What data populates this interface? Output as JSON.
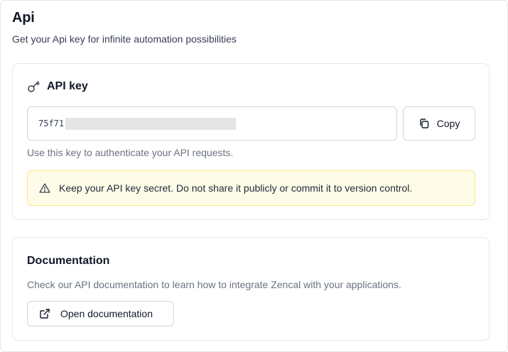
{
  "page": {
    "title": "Api",
    "subtitle": "Get your Api key for infinite automation possibilities"
  },
  "api_card": {
    "title": "API key",
    "title_icon": "key-icon",
    "key_prefix": "75f71",
    "copy_label": "Copy",
    "copy_icon": "copy-icon",
    "help_text": "Use this key to authenticate your API requests.",
    "warning_text": "Keep your API key secret. Do not share it publicly or commit it to version control.",
    "warning_icon": "warning-triangle-icon",
    "warning_bg": "#fefce8"
  },
  "docs_card": {
    "title": "Documentation",
    "text": "Check our API documentation to learn how to integrate Zencal with your applications.",
    "button_label": "Open documentation",
    "button_icon": "external-link-icon"
  }
}
